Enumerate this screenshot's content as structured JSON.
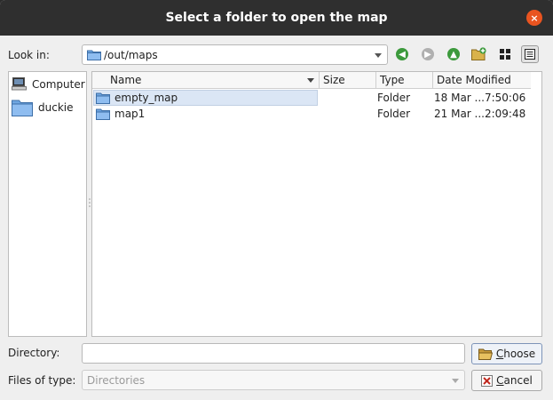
{
  "window": {
    "title": "Select a folder to open the map",
    "close_glyph": "×"
  },
  "look_in": {
    "label": "Look in:",
    "path": "/out/maps"
  },
  "sidebar": {
    "items": [
      {
        "label": "Computer",
        "icon": "computer-icon"
      },
      {
        "label": "duckie",
        "icon": "folder-icon"
      }
    ]
  },
  "file_table": {
    "columns": [
      "Name",
      "Size",
      "Type",
      "Date Modified"
    ],
    "rows": [
      {
        "name": "empty_map",
        "size": "",
        "type": "Folder",
        "modified": "18 Mar ...7:50:06"
      },
      {
        "name": "map1",
        "size": "",
        "type": "Folder",
        "modified": "21 Mar ...2:09:48"
      }
    ]
  },
  "directory": {
    "label": "Directory:",
    "value": ""
  },
  "files_of_type": {
    "label": "Files of type:",
    "value": "Directories"
  },
  "buttons": {
    "choose_first": "C",
    "choose_rest": "hoose",
    "cancel_first": "C",
    "cancel_rest": "ancel"
  },
  "colors": {
    "accent_close": "#e95420",
    "nav_green": "#3c9a3c",
    "nav_gray": "#b0b0b0",
    "selection": "#dbe6f5"
  }
}
